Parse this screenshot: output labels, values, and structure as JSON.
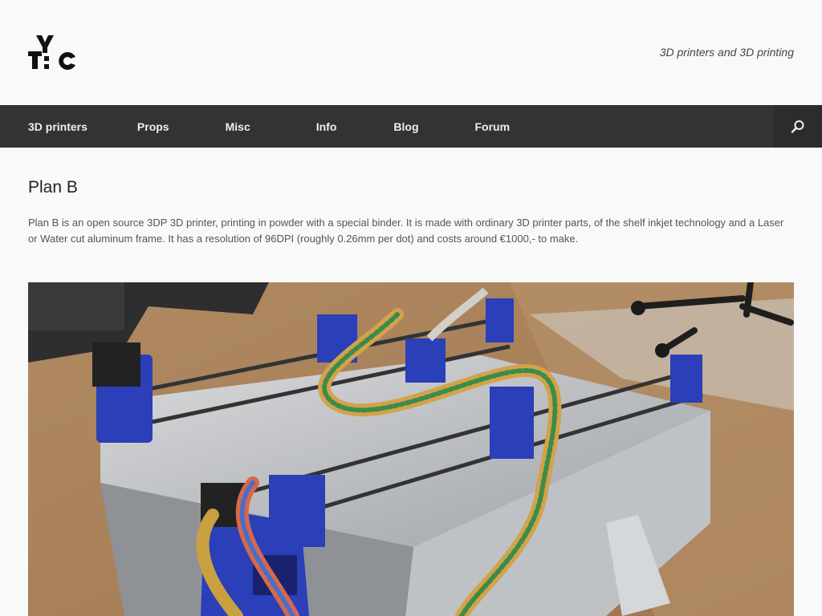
{
  "header": {
    "logo_text": "TYC",
    "tagline": "3D printers and 3D printing"
  },
  "nav": {
    "items": [
      {
        "label": "3D printers"
      },
      {
        "label": "Props"
      },
      {
        "label": "Misc"
      },
      {
        "label": "Info"
      },
      {
        "label": "Blog"
      },
      {
        "label": "Forum"
      }
    ],
    "search_icon": "search-icon"
  },
  "main": {
    "title": "Plan B",
    "intro": "Plan B is an open source 3DP 3D printer, printing in powder with a special binder. It is made with ordinary 3D printer parts, of the shelf inkjet technology and a Laser or Water cut aluminum frame. It has a resolution of 96DPI (roughly 0.26mm per dot) and costs around €1000,- to make."
  },
  "colors": {
    "navbar": "#313335",
    "background": "#f9f9f9",
    "frame_blue": "#2a3fb8"
  }
}
